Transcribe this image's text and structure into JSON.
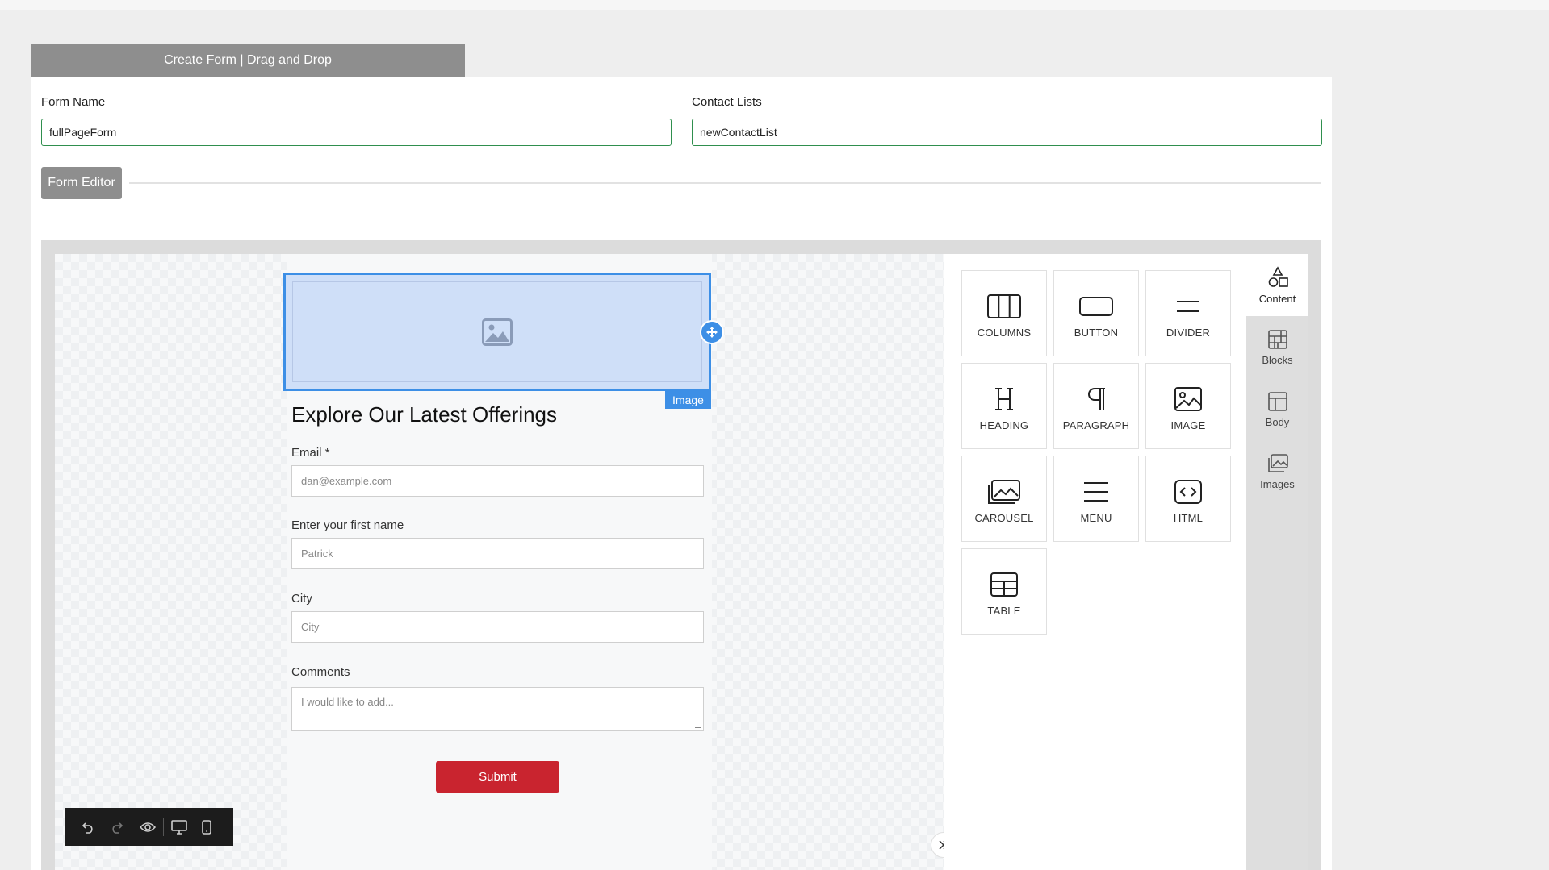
{
  "header": {
    "title": "Create Form | Drag and Drop"
  },
  "form_name": {
    "label": "Form Name",
    "value": "fullPageForm"
  },
  "contact_lists": {
    "label": "Contact Lists",
    "value": "newContactList"
  },
  "form_editor": {
    "label": "Form Editor"
  },
  "canvas": {
    "image_tag": "Image",
    "title": "Explore Our Latest Offerings",
    "fields": [
      {
        "label": "Email *",
        "placeholder": "dan@example.com"
      },
      {
        "label": "Enter your first name",
        "placeholder": "Patrick"
      },
      {
        "label": "City",
        "placeholder": "City"
      },
      {
        "label": "Comments",
        "placeholder": "I would like to add..."
      }
    ],
    "submit_label": "Submit"
  },
  "blocks": [
    {
      "label": "COLUMNS",
      "icon": "columns-icon"
    },
    {
      "label": "BUTTON",
      "icon": "button-icon"
    },
    {
      "label": "DIVIDER",
      "icon": "divider-icon"
    },
    {
      "label": "HEADING",
      "icon": "heading-icon"
    },
    {
      "label": "PARAGRAPH",
      "icon": "paragraph-icon"
    },
    {
      "label": "IMAGE",
      "icon": "image-icon"
    },
    {
      "label": "CAROUSEL",
      "icon": "carousel-icon"
    },
    {
      "label": "MENU",
      "icon": "menu-icon"
    },
    {
      "label": "HTML",
      "icon": "html-icon"
    },
    {
      "label": "TABLE",
      "icon": "table-icon"
    }
  ],
  "side_tabs": [
    {
      "label": "Content",
      "icon": "shapes-icon",
      "active": true
    },
    {
      "label": "Blocks",
      "icon": "blocks-icon",
      "active": false
    },
    {
      "label": "Body",
      "icon": "body-icon",
      "active": false
    },
    {
      "label": "Images",
      "icon": "images-icon",
      "active": false
    }
  ],
  "colors": {
    "accent": "#3d8fe6",
    "submit": "#c9242f",
    "input_border": "#2f8f4e",
    "header_bg": "#8e8e8e"
  }
}
